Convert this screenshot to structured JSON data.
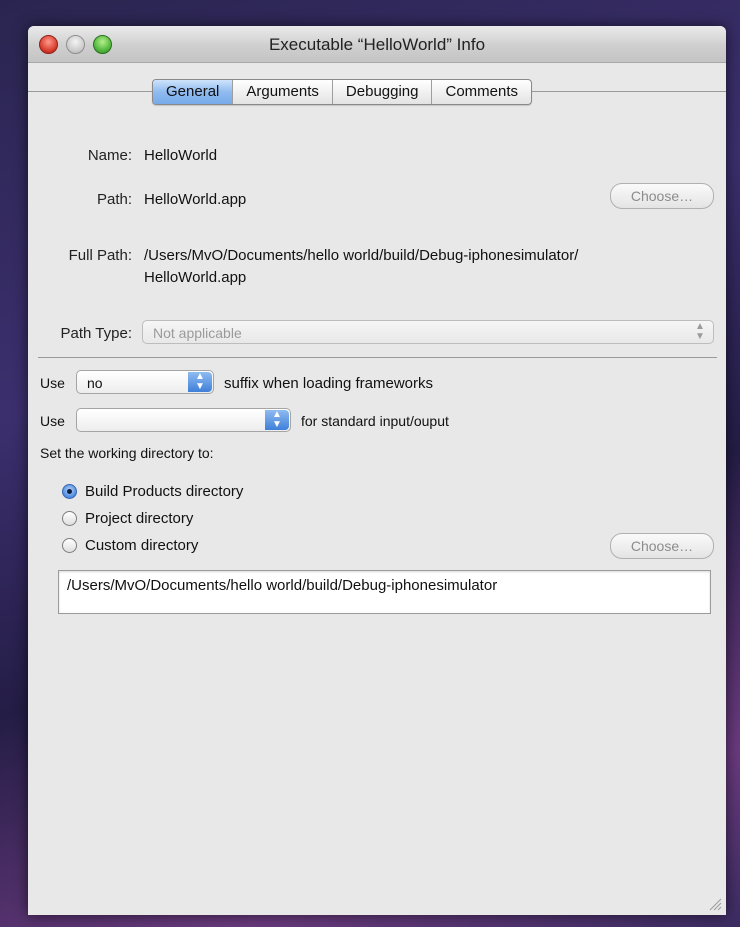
{
  "window": {
    "title": "Executable “HelloWorld” Info"
  },
  "tabs": [
    {
      "label": "General",
      "active": true
    },
    {
      "label": "Arguments",
      "active": false
    },
    {
      "label": "Debugging",
      "active": false
    },
    {
      "label": "Comments",
      "active": false
    }
  ],
  "general": {
    "name_label": "Name:",
    "name_value": "HelloWorld",
    "path_label": "Path:",
    "path_value": "HelloWorld.app",
    "choose_label": "Choose…",
    "full_path_label": "Full Path:",
    "full_path_line1": "/Users/MvO/Documents/hello world/build/Debug-iphonesimulator/",
    "full_path_line2": "HelloWorld.app",
    "path_type_label": "Path Type:",
    "path_type_value": "Not applicable"
  },
  "options": {
    "use1_label": "Use",
    "suffix_value": "no",
    "suffix_text": "suffix when loading frameworks",
    "use2_label": "Use",
    "stdio_value": "",
    "stdio_text": "for standard input/ouput",
    "working_dir_label": "Set the working directory to:",
    "radios": [
      {
        "label": "Build Products directory",
        "checked": true
      },
      {
        "label": "Project directory",
        "checked": false
      },
      {
        "label": "Custom directory",
        "checked": false
      }
    ],
    "custom_choose_label": "Choose…",
    "working_dir_value": "/Users/MvO/Documents/hello world/build/Debug-iphonesimulator"
  }
}
